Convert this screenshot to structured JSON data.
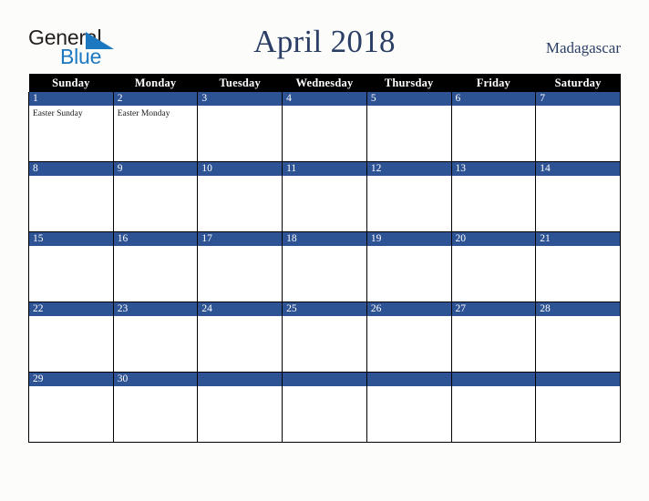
{
  "brand": {
    "logo_text_primary": "General",
    "logo_text_secondary": "Blue",
    "logo_primary_color": "#231f20",
    "logo_secondary_color": "#1c78c0",
    "triangle_icon": "triangle-icon"
  },
  "header": {
    "title": "April 2018",
    "title_color": "#2b3f66",
    "country": "Madagascar",
    "country_color": "#2b3f66"
  },
  "calendar": {
    "month": "April",
    "year": "2018",
    "header_background": "#000000",
    "header_text_color": "#ffffff",
    "date_bar_color": "#2e5395",
    "date_text_color": "#ffffff",
    "cell_background": "#ffffff",
    "border_color": "#000000",
    "weekdays": [
      "Sunday",
      "Monday",
      "Tuesday",
      "Wednesday",
      "Thursday",
      "Friday",
      "Saturday"
    ],
    "weeks": [
      [
        {
          "day": "1",
          "events": [
            "Easter Sunday"
          ]
        },
        {
          "day": "2",
          "events": [
            "Easter Monday"
          ]
        },
        {
          "day": "3",
          "events": []
        },
        {
          "day": "4",
          "events": []
        },
        {
          "day": "5",
          "events": []
        },
        {
          "day": "6",
          "events": []
        },
        {
          "day": "7",
          "events": []
        }
      ],
      [
        {
          "day": "8",
          "events": []
        },
        {
          "day": "9",
          "events": []
        },
        {
          "day": "10",
          "events": []
        },
        {
          "day": "11",
          "events": []
        },
        {
          "day": "12",
          "events": []
        },
        {
          "day": "13",
          "events": []
        },
        {
          "day": "14",
          "events": []
        }
      ],
      [
        {
          "day": "15",
          "events": []
        },
        {
          "day": "16",
          "events": []
        },
        {
          "day": "17",
          "events": []
        },
        {
          "day": "18",
          "events": []
        },
        {
          "day": "19",
          "events": []
        },
        {
          "day": "20",
          "events": []
        },
        {
          "day": "21",
          "events": []
        }
      ],
      [
        {
          "day": "22",
          "events": []
        },
        {
          "day": "23",
          "events": []
        },
        {
          "day": "24",
          "events": []
        },
        {
          "day": "25",
          "events": []
        },
        {
          "day": "26",
          "events": []
        },
        {
          "day": "27",
          "events": []
        },
        {
          "day": "28",
          "events": []
        }
      ],
      [
        {
          "day": "29",
          "events": []
        },
        {
          "day": "30",
          "events": []
        },
        {
          "day": "",
          "events": []
        },
        {
          "day": "",
          "events": []
        },
        {
          "day": "",
          "events": []
        },
        {
          "day": "",
          "events": []
        },
        {
          "day": "",
          "events": []
        }
      ]
    ]
  }
}
